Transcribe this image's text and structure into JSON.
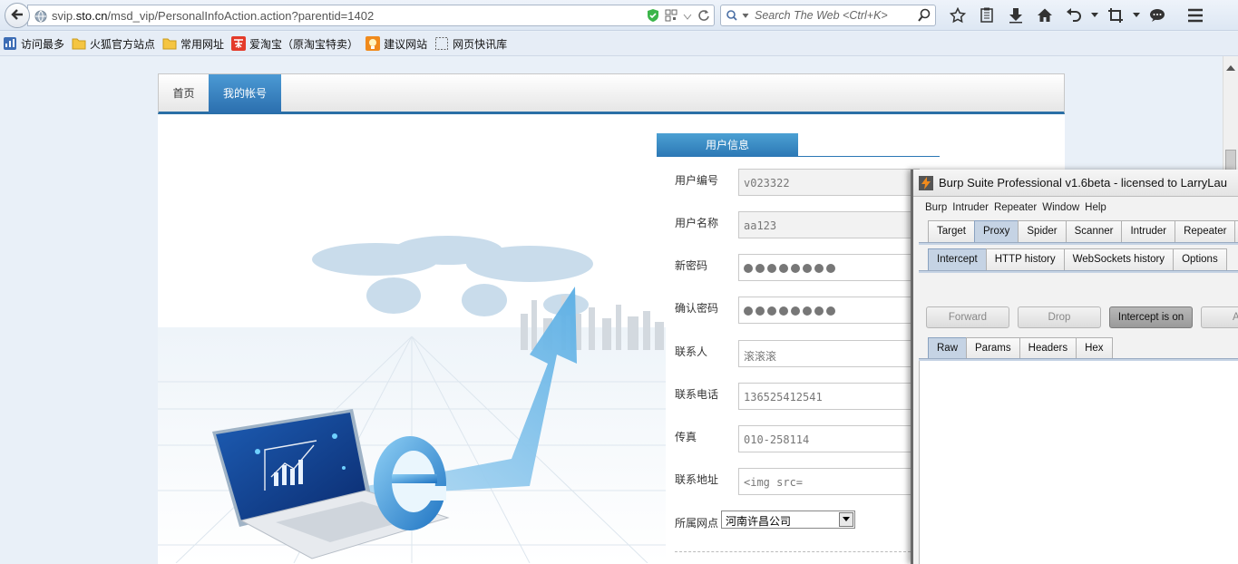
{
  "browser": {
    "url_prefix": "svip.",
    "url_domain": "sto.cn",
    "url_path": "/msd_vip/PersonalInfoAction.action?parentid=1402",
    "search_placeholder": "Search The Web <Ctrl+K>",
    "bookmarks": [
      {
        "label": "访问最多",
        "icon": "most-visited-icon"
      },
      {
        "label": "火狐官方站点",
        "icon": "folder-icon"
      },
      {
        "label": "常用网址",
        "icon": "folder-icon"
      },
      {
        "label": "爱淘宝（原淘宝特卖）",
        "icon": "taobao-icon"
      },
      {
        "label": "建议网站",
        "icon": "suggested-sites-icon"
      },
      {
        "label": "网页快讯库",
        "icon": "web-slice-icon"
      }
    ]
  },
  "site": {
    "nav": {
      "home": "首页",
      "account": "我的帐号"
    },
    "section_title": "用户信息",
    "fields": {
      "user_id": {
        "label": "用户编号",
        "value": "v023322"
      },
      "username": {
        "label": "用户名称",
        "value": "aa123"
      },
      "new_password": {
        "label": "新密码",
        "value": "••••••••"
      },
      "confirm_password": {
        "label": "确认密码",
        "value": "••••••••"
      },
      "contact": {
        "label": "联系人",
        "value": "滚滚滚"
      },
      "phone": {
        "label": "联系电话",
        "value": "136525412541"
      },
      "fax": {
        "label": "传真",
        "value": "010-258114"
      },
      "address": {
        "label": "联系地址",
        "value": "<img src="
      }
    },
    "branch": {
      "label": "所属网点",
      "value": "河南许昌公司"
    }
  },
  "burp": {
    "title": "Burp Suite Professional v1.6beta - licensed to LarryLau",
    "menu": [
      "Burp",
      "Intruder",
      "Repeater",
      "Window",
      "Help"
    ],
    "main_tabs": [
      "Target",
      "Proxy",
      "Spider",
      "Scanner",
      "Intruder",
      "Repeater",
      "S"
    ],
    "main_selected": "Proxy",
    "proxy_tabs": [
      "Intercept",
      "HTTP history",
      "WebSockets history",
      "Options"
    ],
    "proxy_selected": "Intercept",
    "buttons": {
      "forward": "Forward",
      "drop": "Drop",
      "intercept": "Intercept is on",
      "action": "Ac"
    },
    "view_tabs": [
      "Raw",
      "Params",
      "Headers",
      "Hex"
    ],
    "view_selected": "Raw"
  },
  "colors": {
    "accent": "#2b6fae",
    "burp_selected_tab": "#c5d3e4"
  }
}
